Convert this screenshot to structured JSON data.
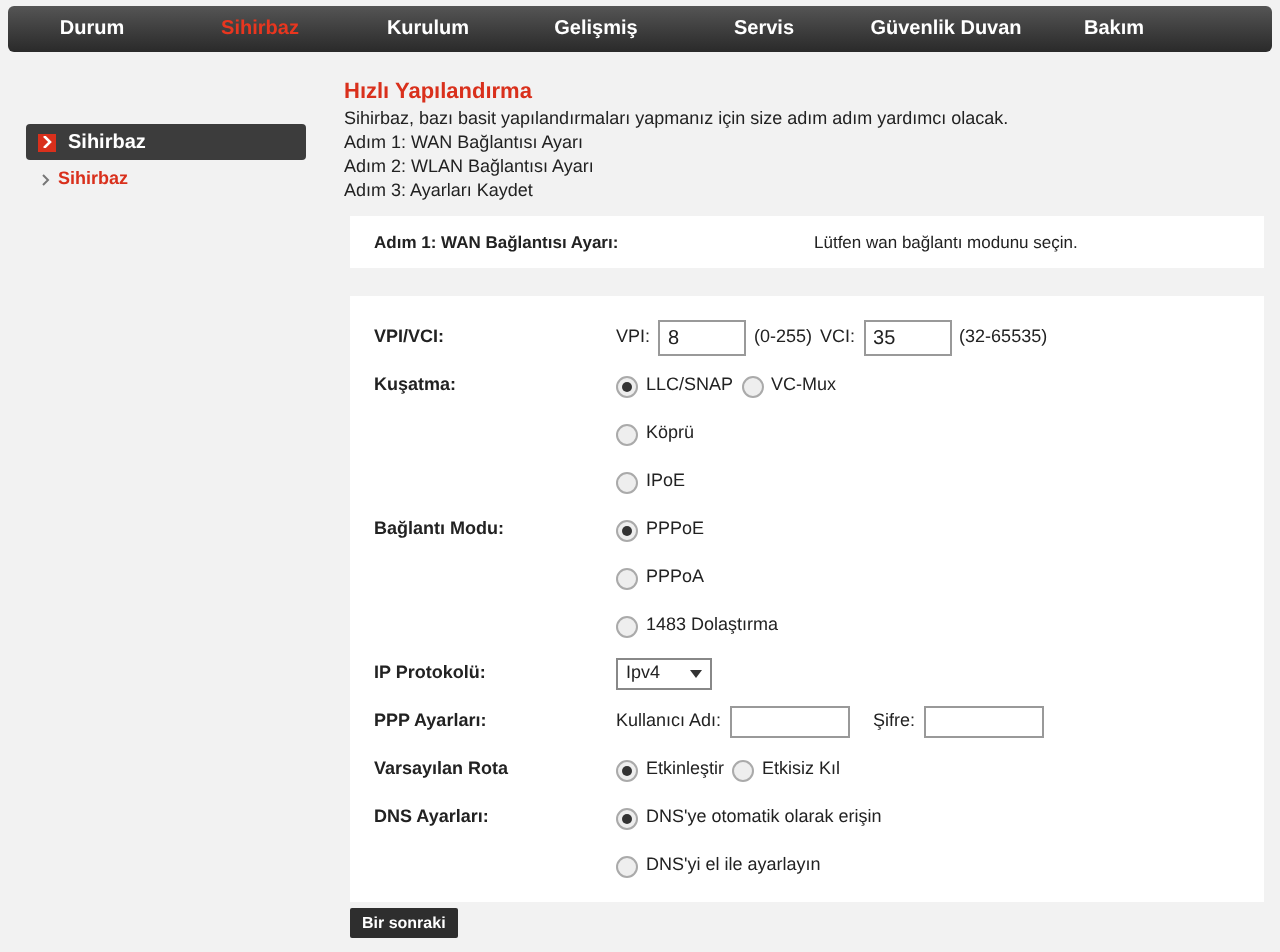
{
  "nav": [
    {
      "label": "Durum",
      "selected": false
    },
    {
      "label": "Sihirbaz",
      "selected": true
    },
    {
      "label": "Kurulum",
      "selected": false
    },
    {
      "label": "Gelişmiş",
      "selected": false
    },
    {
      "label": "Servis",
      "selected": false
    },
    {
      "label": "Güvenlik Duvan",
      "selected": false
    },
    {
      "label": "Bakım",
      "selected": false
    }
  ],
  "sidebar": {
    "header": "Sihirbaz",
    "items": [
      {
        "label": "Sihirbaz",
        "selected": true
      }
    ]
  },
  "title": "Hızlı Yapılandırma",
  "intro": [
    "Sihirbaz, bazı basit yapılandırmaları yapmanız için size adım adım yardımcı olacak.",
    "Adım 1: WAN Bağlantısı Ayarı",
    "Adım 2: WLAN Bağlantısı Ayarı",
    "Adım 3: Ayarları Kaydet"
  ],
  "step": {
    "label": "Adım 1: WAN Bağlantısı Ayarı:",
    "hint": "Lütfen wan bağlantı modunu seçin."
  },
  "rows": [
    {
      "kind": "vpi",
      "label": "VPI/VCI:",
      "vpi_label": "VPI:",
      "vpi": "8",
      "vpi_range": "(0-255)",
      "vci_label": "VCI:",
      "vci": "35",
      "vci_range": "(32-65535)"
    },
    {
      "kind": "radio",
      "label": "Kuşatma:",
      "options": [
        {
          "label": "LLC/SNAP",
          "selected": true
        },
        {
          "label": "VC-Mux",
          "selected": false
        }
      ]
    },
    {
      "kind": "radio",
      "options": [
        {
          "label": "Köprü",
          "selected": false
        }
      ]
    },
    {
      "kind": "radio",
      "options": [
        {
          "label": "IPoE",
          "selected": false
        }
      ]
    },
    {
      "kind": "radio",
      "label": "Bağlantı Modu:",
      "options": [
        {
          "label": "PPPoE",
          "selected": true
        }
      ]
    },
    {
      "kind": "radio",
      "options": [
        {
          "label": "PPPoA",
          "selected": false
        }
      ]
    },
    {
      "kind": "radio",
      "options": [
        {
          "label": "1483 Dolaştırma",
          "selected": false
        }
      ]
    },
    {
      "kind": "select",
      "label": "IP Protokolü:",
      "value": "Ipv4"
    },
    {
      "kind": "credentials",
      "label": "PPP Ayarları:",
      "user_label": "Kullanıcı Adı:",
      "pass_label": "Şifre:"
    },
    {
      "kind": "radio",
      "label": "Varsayılan Rota",
      "options": [
        {
          "label": "Etkinleştir",
          "selected": true
        },
        {
          "label": "Etkisiz Kıl",
          "selected": false
        }
      ]
    },
    {
      "kind": "radio",
      "label": "DNS Ayarları:",
      "options": [
        {
          "label": "DNS'ye otomatik olarak erişin",
          "selected": true
        }
      ]
    },
    {
      "kind": "radio",
      "options": [
        {
          "label": "DNS'yi el ile ayarlayın",
          "selected": false
        }
      ]
    }
  ],
  "next_button": "Bir sonraki"
}
